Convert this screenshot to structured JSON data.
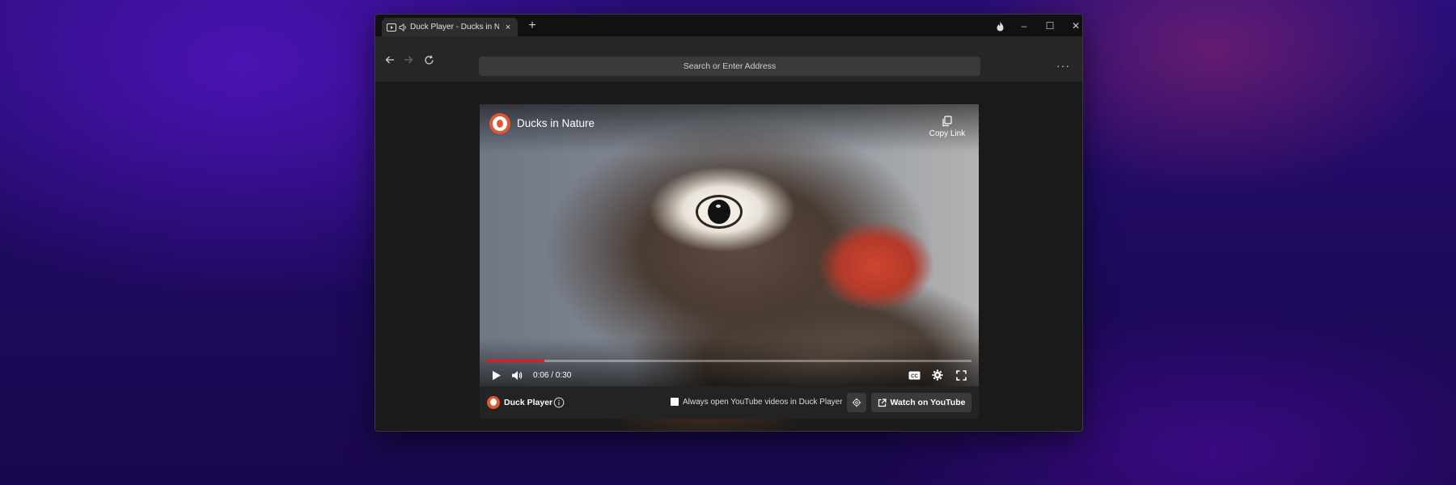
{
  "tab": {
    "title": "Duck Player - Ducks in Nature",
    "close_label": "×"
  },
  "new_tab_label": "+",
  "window_controls": {
    "fire_icon": "fire-icon",
    "minimize": "–",
    "maximize": "☐",
    "close": "✕"
  },
  "navigation": {
    "address_placeholder": "Search or Enter Address",
    "more_label": "···"
  },
  "video": {
    "title": "Ducks in Nature",
    "copy_link_label": "Copy Link",
    "time": "0:06 / 0:30",
    "progress": 0.12
  },
  "duck_player_bar": {
    "brand": "Duck Player",
    "always_open_label": "Always open YouTube videos in Duck Player",
    "always_open_checked": false,
    "watch_label": "Watch on YouTube"
  },
  "colors": {
    "accent": "#de5833",
    "progress": "#e31b1b"
  }
}
